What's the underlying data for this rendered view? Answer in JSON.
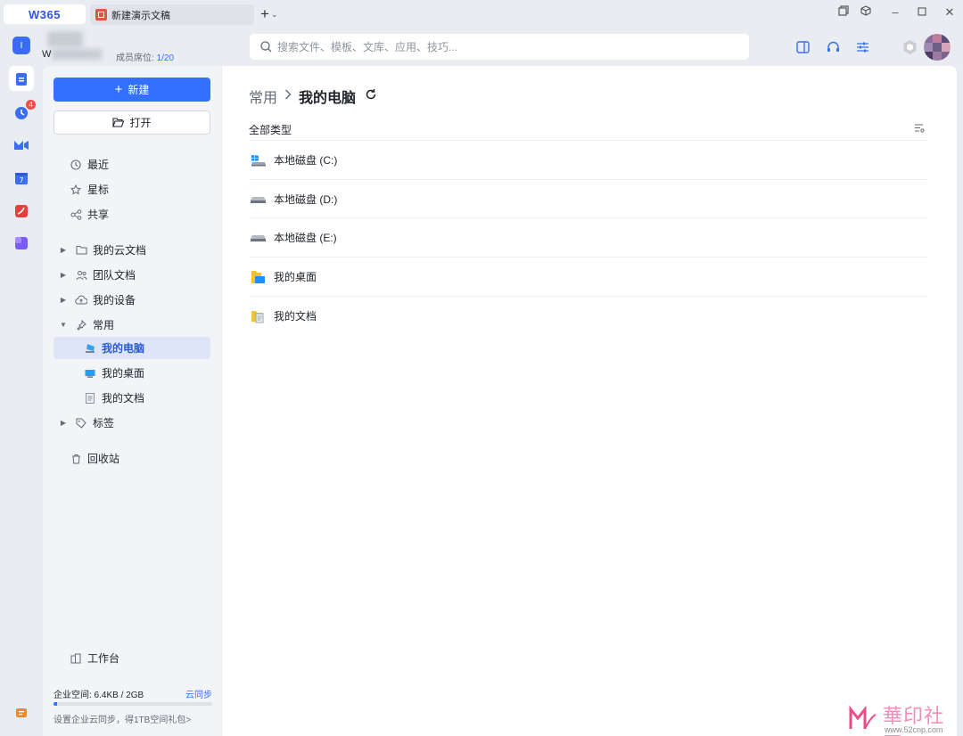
{
  "titlebar": {
    "logo": "W365",
    "tab_title": "新建演示文稿"
  },
  "team": {
    "avatar": "I",
    "name": "W",
    "seats_label": "成员席位:",
    "seats_value": "1/20"
  },
  "search": {
    "placeholder": "搜索文件、模板、文库、应用、技巧..."
  },
  "rail": {
    "badge": "4"
  },
  "sidebar": {
    "new_label": "新建",
    "open_label": "打开",
    "items": [
      {
        "label": "最近",
        "icon": "clock-icon"
      },
      {
        "label": "星标",
        "icon": "star-icon"
      },
      {
        "label": "共享",
        "icon": "share-icon"
      },
      {
        "label": "我的云文档",
        "icon": "folder-icon"
      },
      {
        "label": "团队文档",
        "icon": "team-icon"
      },
      {
        "label": "我的设备",
        "icon": "cloud-icon"
      },
      {
        "label": "常用",
        "icon": "pin-icon"
      },
      {
        "label": "我的电脑",
        "icon": "computer-icon"
      },
      {
        "label": "我的桌面",
        "icon": "desktop-icon"
      },
      {
        "label": "我的文档",
        "icon": "document-icon"
      },
      {
        "label": "标签",
        "icon": "tag-icon"
      },
      {
        "label": "回收站",
        "icon": "trash-icon"
      }
    ],
    "workbench": "工作台",
    "storage": {
      "label": "企业空间: 6.4KB / 2GB",
      "sync": "云同步",
      "fraction": 0.02,
      "tip": "设置企业云同步，得1TB空间礼包>"
    }
  },
  "main": {
    "breadcrumb": [
      "常用",
      "我的电脑"
    ],
    "filter": "全部类型",
    "rows": [
      {
        "name": "本地磁盘 (C:)",
        "icon": "system-drive-icon"
      },
      {
        "name": "本地磁盘 (D:)",
        "icon": "drive-icon"
      },
      {
        "name": "本地磁盘 (E:)",
        "icon": "drive-icon"
      },
      {
        "name": "我的桌面",
        "icon": "desktop-folder-icon"
      },
      {
        "name": "我的文档",
        "icon": "documents-folder-icon"
      }
    ]
  },
  "watermark": {
    "text": "華印社區",
    "url": "www.52cnp.com"
  },
  "colors": {
    "accent": "#3370ff",
    "background": "#e9edf2",
    "sidebar": "#f2f4f7",
    "active_item": "#dde5f6"
  }
}
